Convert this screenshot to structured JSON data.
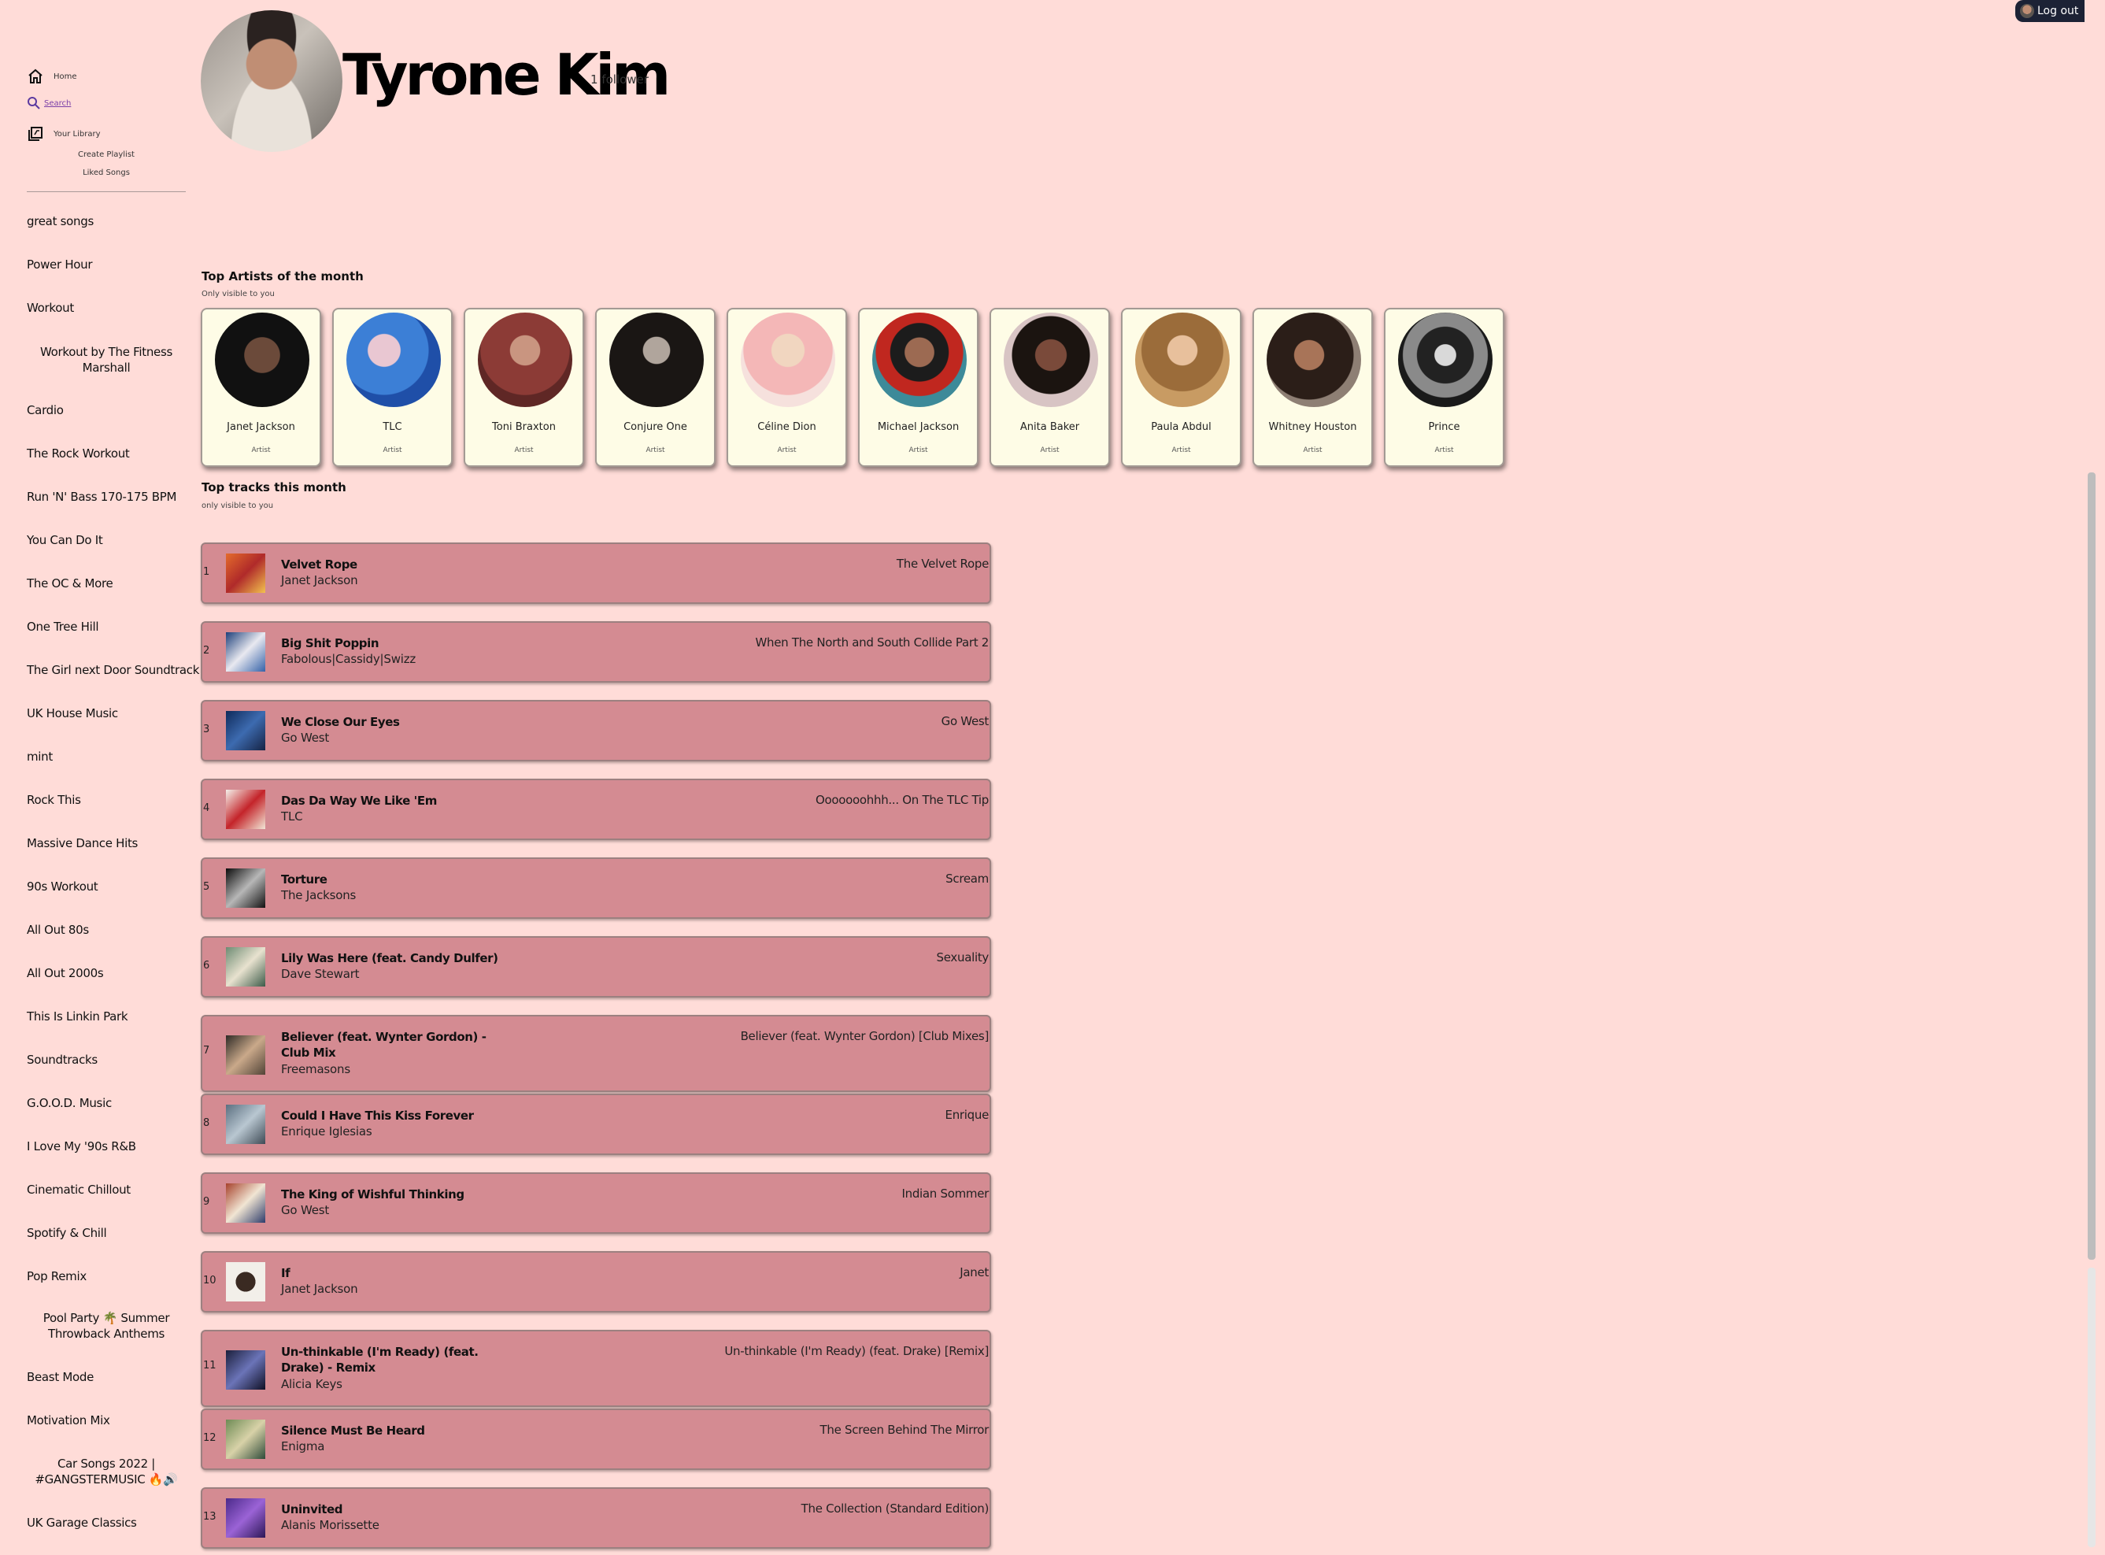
{
  "header": {
    "name": "Tyrone Kim",
    "followers": "1 follower",
    "logout_label": "Log out"
  },
  "nav": {
    "home": "Home",
    "search": "Search",
    "library": "Your Library",
    "create_playlist": "Create Playlist",
    "liked_songs": "Liked Songs"
  },
  "playlists": [
    "great songs",
    "Power Hour",
    "Workout",
    "Workout by The Fitness Marshall",
    "Cardio",
    "The Rock Workout",
    "Run 'N' Bass 170-175 BPM",
    "You Can Do It",
    "The OC & More",
    "One Tree Hill",
    "The Girl next Door Soundtrack",
    "UK House Music",
    "mint",
    "Rock This",
    "Massive Dance Hits",
    "90s Workout",
    "All Out 80s",
    "All Out 2000s",
    "This Is Linkin Park",
    "Soundtracks",
    "G.O.O.D. Music",
    "I Love My '90s R&B",
    "Cinematic Chillout",
    "Spotify & Chill",
    "Pop Remix",
    "Pool Party 🌴 Summer Throwback Anthems",
    "Beast Mode",
    "Motivation Mix",
    "Car Songs 2022 | #GANGSTERMUSIC 🔥🔊",
    "UK Garage Classics"
  ],
  "top_artists": {
    "title": "Top Artists of the month",
    "subtitle": "Only visible to you",
    "items": [
      {
        "name": "Janet Jackson",
        "type": "Artist"
      },
      {
        "name": "TLC",
        "type": "Artist"
      },
      {
        "name": "Toni Braxton",
        "type": "Artist"
      },
      {
        "name": "Conjure One",
        "type": "Artist"
      },
      {
        "name": "Céline Dion",
        "type": "Artist"
      },
      {
        "name": "Michael Jackson",
        "type": "Artist"
      },
      {
        "name": "Anita Baker",
        "type": "Artist"
      },
      {
        "name": "Paula Abdul",
        "type": "Artist"
      },
      {
        "name": "Whitney Houston",
        "type": "Artist"
      },
      {
        "name": "Prince",
        "type": "Artist"
      }
    ]
  },
  "top_tracks": {
    "title": "Top tracks this month",
    "subtitle": "only visible to you",
    "items": [
      {
        "num": "1",
        "title": "Velvet Rope",
        "artist": "Janet Jackson",
        "album": "The Velvet Rope"
      },
      {
        "num": "2",
        "title": "Big Shit Poppin",
        "artist": "Fabolous|Cassidy|Swizz",
        "album": "When The North and South Collide Part 2"
      },
      {
        "num": "3",
        "title": "We Close Our Eyes",
        "artist": "Go West",
        "album": "Go West"
      },
      {
        "num": "4",
        "title": "Das Da Way We Like 'Em",
        "artist": "TLC",
        "album": "Ooooooohhh... On The TLC Tip"
      },
      {
        "num": "5",
        "title": "Torture",
        "artist": "The Jacksons",
        "album": "Scream"
      },
      {
        "num": "6",
        "title": "Lily Was Here (feat. Candy Dulfer)",
        "artist": "Dave Stewart",
        "album": "Sexuality"
      },
      {
        "num": "7",
        "title": "Believer (feat. Wynter Gordon) - Club Mix",
        "artist": "Freemasons",
        "album": "Believer (feat. Wynter Gordon) [Club Mixes]"
      },
      {
        "num": "8",
        "title": "Could I Have This Kiss Forever",
        "artist": "Enrique Iglesias",
        "album": "Enrique"
      },
      {
        "num": "9",
        "title": "The King of Wishful Thinking",
        "artist": "Go West",
        "album": "Indian Sommer"
      },
      {
        "num": "10",
        "title": "If",
        "artist": "Janet Jackson",
        "album": "Janet"
      },
      {
        "num": "11",
        "title": "Un-thinkable (I'm Ready) (feat. Drake) - Remix",
        "artist": "Alicia Keys",
        "album": "Un-thinkable (I'm Ready) (feat. Drake) [Remix]"
      },
      {
        "num": "12",
        "title": "Silence Must Be Heard",
        "artist": "Enigma",
        "album": "The Screen Behind The Mirror"
      },
      {
        "num": "13",
        "title": "Uninvited",
        "artist": "Alanis Morissette",
        "album": "The Collection (Standard Edition)"
      }
    ]
  }
}
